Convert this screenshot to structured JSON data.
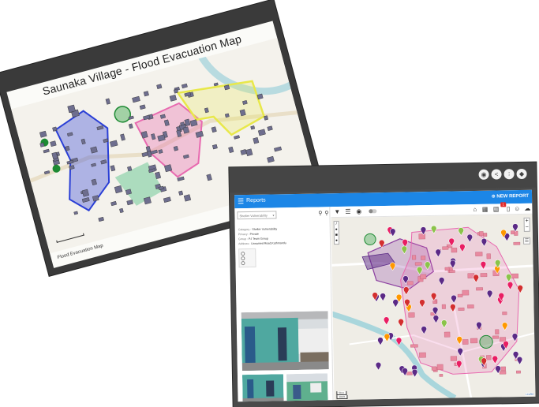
{
  "back_map": {
    "title": "Saunaka Village - Flood Evacuation Map",
    "legend": "Flood Evacuation Map"
  },
  "app": {
    "topbar_icons": [
      "pin-icon",
      "share-icon",
      "rss-icon",
      "lock-icon"
    ],
    "header": {
      "title": "Reports",
      "new_report_label": "NEW REPORT"
    },
    "filter": {
      "selected": "Shelter Vulnerability"
    },
    "detail": {
      "rows": [
        {
          "key": "Category",
          "value": "Shelter Vulnerability"
        },
        {
          "key": "Privacy",
          "value": "Private"
        },
        {
          "key": "Group",
          "value": "PJ Team Group"
        },
        {
          "key": "Address",
          "value": "Unnamed Road,Kathmandu"
        }
      ]
    },
    "toolbar": {
      "badge_count": "1"
    },
    "map": {
      "scale_m": "50 m",
      "scale_ft": "100 ft",
      "attribution": "Leaflet"
    },
    "colors": {
      "header_blue": "#1c86e6",
      "evacuation_blue": "#2a3fd6",
      "zone_pink": "#e86ab0",
      "zone_yellow": "#e8e84a",
      "marker_purple": "#5b2a86"
    }
  }
}
